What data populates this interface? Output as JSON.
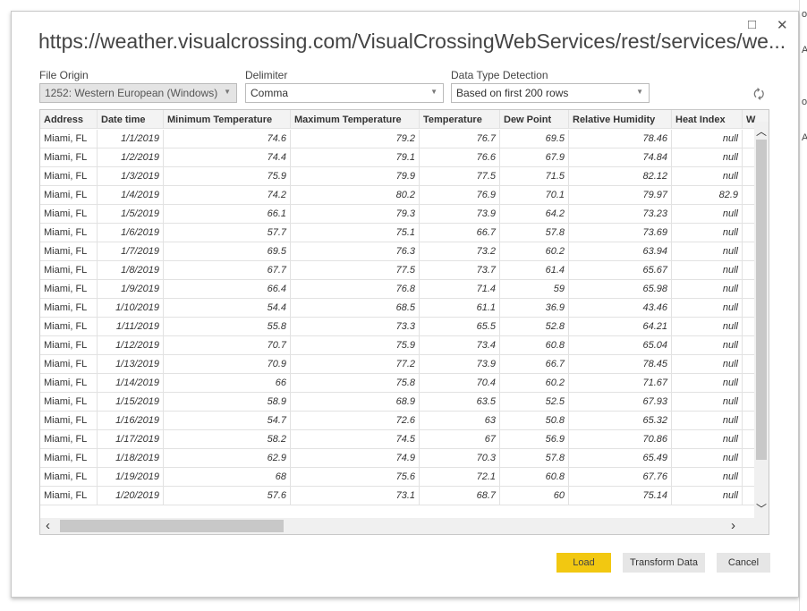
{
  "title": "https://weather.visualcrossing.com/VisualCrossingWebServices/rest/services/we...",
  "window": {
    "maximize_icon": "□",
    "close_icon": "✕"
  },
  "background_fragments": [
    "o",
    "A",
    "o",
    "A"
  ],
  "file_origin": {
    "label": "File Origin",
    "value": "1252: Western European (Windows)"
  },
  "delimiter": {
    "label": "Delimiter",
    "value": "Comma"
  },
  "data_type_detection": {
    "label": "Data Type Detection",
    "value": "Based on first 200 rows"
  },
  "table": {
    "columns": [
      "Address",
      "Date time",
      "Minimum Temperature",
      "Maximum Temperature",
      "Temperature",
      "Dew Point",
      "Relative Humidity",
      "Heat Index",
      "W"
    ],
    "rows": [
      [
        "Miami, FL",
        "1/1/2019",
        "74.6",
        "79.2",
        "76.7",
        "69.5",
        "78.46",
        "null"
      ],
      [
        "Miami, FL",
        "1/2/2019",
        "74.4",
        "79.1",
        "76.6",
        "67.9",
        "74.84",
        "null"
      ],
      [
        "Miami, FL",
        "1/3/2019",
        "75.9",
        "79.9",
        "77.5",
        "71.5",
        "82.12",
        "null"
      ],
      [
        "Miami, FL",
        "1/4/2019",
        "74.2",
        "80.2",
        "76.9",
        "70.1",
        "79.97",
        "82.9"
      ],
      [
        "Miami, FL",
        "1/5/2019",
        "66.1",
        "79.3",
        "73.9",
        "64.2",
        "73.23",
        "null"
      ],
      [
        "Miami, FL",
        "1/6/2019",
        "57.7",
        "75.1",
        "66.7",
        "57.8",
        "73.69",
        "null"
      ],
      [
        "Miami, FL",
        "1/7/2019",
        "69.5",
        "76.3",
        "73.2",
        "60.2",
        "63.94",
        "null"
      ],
      [
        "Miami, FL",
        "1/8/2019",
        "67.7",
        "77.5",
        "73.7",
        "61.4",
        "65.67",
        "null"
      ],
      [
        "Miami, FL",
        "1/9/2019",
        "66.4",
        "76.8",
        "71.4",
        "59",
        "65.98",
        "null"
      ],
      [
        "Miami, FL",
        "1/10/2019",
        "54.4",
        "68.5",
        "61.1",
        "36.9",
        "43.46",
        "null"
      ],
      [
        "Miami, FL",
        "1/11/2019",
        "55.8",
        "73.3",
        "65.5",
        "52.8",
        "64.21",
        "null"
      ],
      [
        "Miami, FL",
        "1/12/2019",
        "70.7",
        "75.9",
        "73.4",
        "60.8",
        "65.04",
        "null"
      ],
      [
        "Miami, FL",
        "1/13/2019",
        "70.9",
        "77.2",
        "73.9",
        "66.7",
        "78.45",
        "null"
      ],
      [
        "Miami, FL",
        "1/14/2019",
        "66",
        "75.8",
        "70.4",
        "60.2",
        "71.67",
        "null"
      ],
      [
        "Miami, FL",
        "1/15/2019",
        "58.9",
        "68.9",
        "63.5",
        "52.5",
        "67.93",
        "null"
      ],
      [
        "Miami, FL",
        "1/16/2019",
        "54.7",
        "72.6",
        "63",
        "50.8",
        "65.32",
        "null"
      ],
      [
        "Miami, FL",
        "1/17/2019",
        "58.2",
        "74.5",
        "67",
        "56.9",
        "70.86",
        "null"
      ],
      [
        "Miami, FL",
        "1/18/2019",
        "62.9",
        "74.9",
        "70.3",
        "57.8",
        "65.49",
        "null"
      ],
      [
        "Miami, FL",
        "1/19/2019",
        "68",
        "75.6",
        "72.1",
        "60.8",
        "67.76",
        "null"
      ],
      [
        "Miami, FL",
        "1/20/2019",
        "57.6",
        "73.1",
        "68.7",
        "60",
        "75.14",
        "null"
      ]
    ]
  },
  "buttons": {
    "load": "Load",
    "transform": "Transform Data",
    "cancel": "Cancel"
  },
  "colors": {
    "load_button": "#f2c811"
  }
}
